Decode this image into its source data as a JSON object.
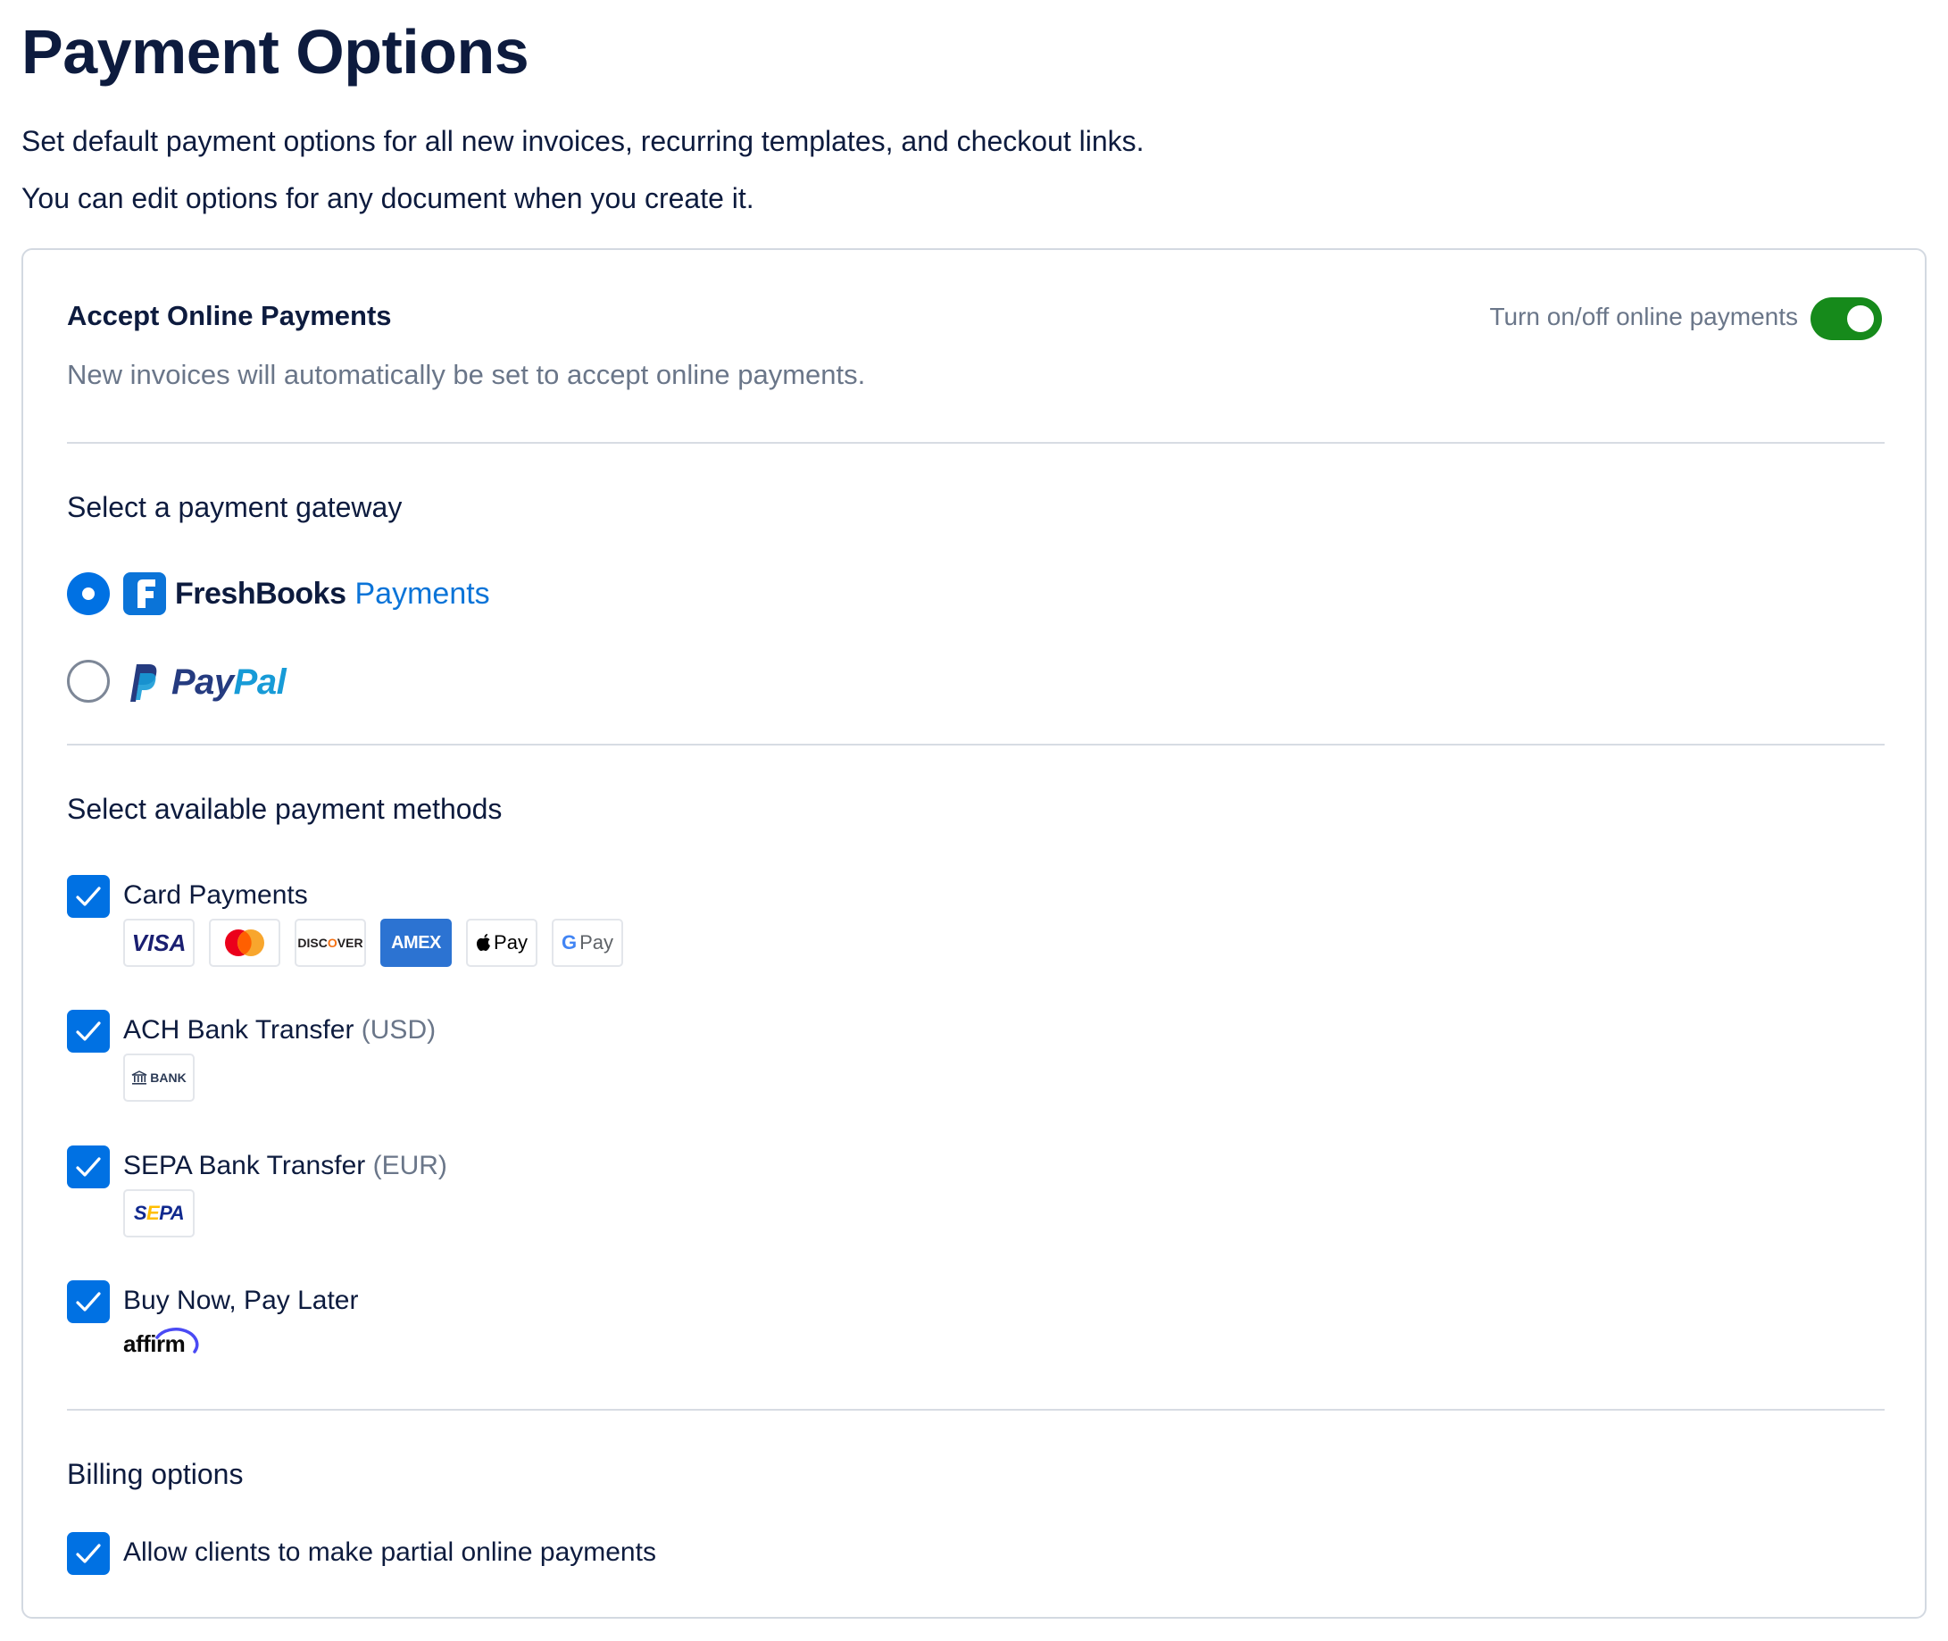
{
  "header": {
    "title": "Payment Options",
    "intro_line1": "Set default payment options for all new invoices, recurring templates, and checkout links.",
    "intro_line2": "You can edit options for any document when you create it."
  },
  "online_payments": {
    "title": "Accept Online Payments",
    "description": "New invoices will automatically be set to accept online payments.",
    "toggle_label": "Turn on/off online payments",
    "toggle_on": true
  },
  "gateway": {
    "title": "Select a payment gateway",
    "options": [
      {
        "brand": "FreshBooks",
        "product": "Payments",
        "selected": true
      },
      {
        "brand_part1": "Pay",
        "brand_part2": "Pal",
        "selected": false
      }
    ]
  },
  "methods": {
    "title": "Select available payment methods",
    "items": [
      {
        "label": "Card Payments",
        "suffix": "",
        "checked": true,
        "badges": [
          "VISA",
          "mastercard",
          "DISCOVER",
          "AMEX",
          "Pay",
          "Pay"
        ]
      },
      {
        "label": "ACH Bank Transfer",
        "suffix": "(USD)",
        "checked": true,
        "badges": [
          "BANK"
        ]
      },
      {
        "label": "SEPA Bank Transfer",
        "suffix": "(EUR)",
        "checked": true,
        "badges": [
          "SEPA"
        ]
      },
      {
        "label": "Buy Now, Pay Later",
        "suffix": "",
        "checked": true,
        "badges": [
          "affirm"
        ]
      }
    ]
  },
  "billing": {
    "title": "Billing options",
    "items": [
      {
        "label": "Allow clients to make partial online payments",
        "checked": true
      }
    ]
  },
  "colors": {
    "primary_blue": "#0071e3",
    "toggle_green": "#168a1b",
    "text_dark": "#0d1b3e",
    "text_muted": "#6a7689",
    "border": "#d3d9e1",
    "paypal_dark": "#253b80",
    "paypal_light": "#179bd7",
    "amex_blue": "#2c73d2"
  }
}
